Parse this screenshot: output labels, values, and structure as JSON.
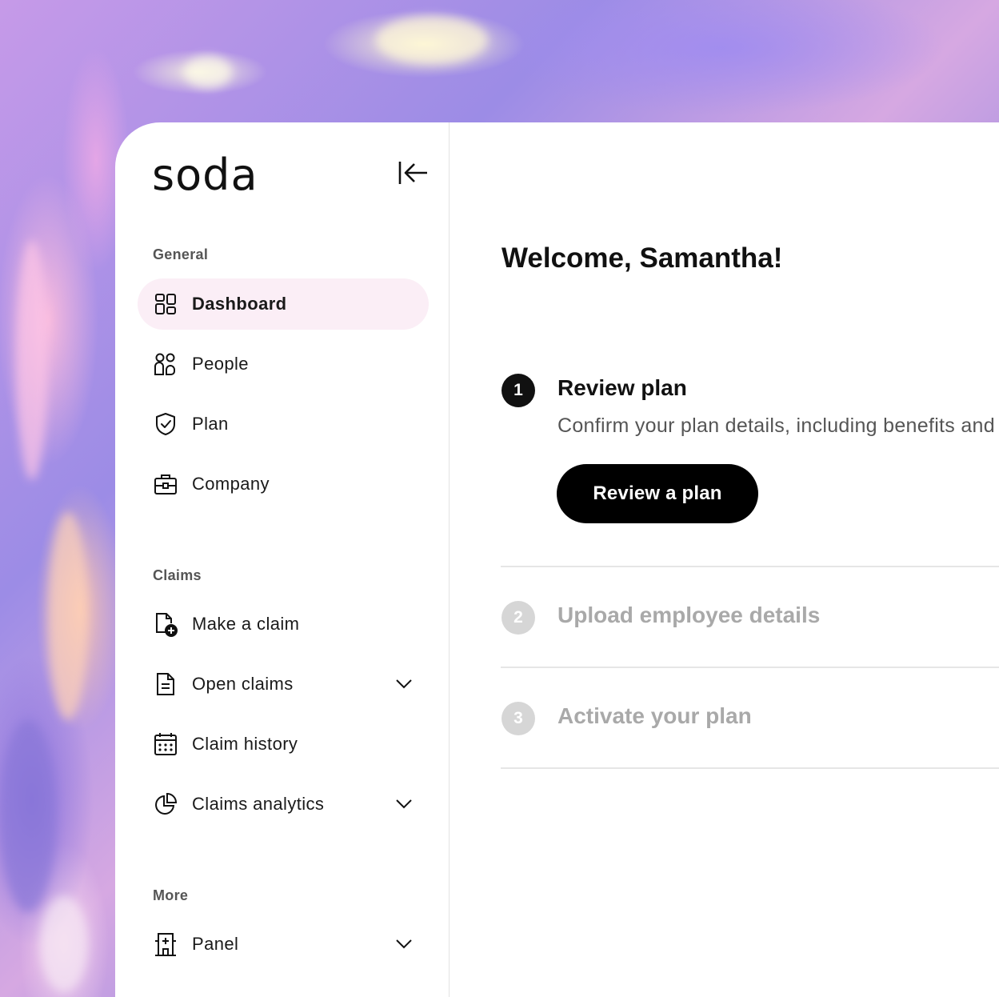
{
  "brand": {
    "logo_text": "soda"
  },
  "sidebar": {
    "collapse_icon": "collapse-left-icon",
    "sections": [
      {
        "label": "General"
      },
      {
        "label": "Claims"
      },
      {
        "label": "More"
      }
    ],
    "items": [
      {
        "label": "Dashboard",
        "icon": "dashboard-grid-icon",
        "active": true
      },
      {
        "label": "People",
        "icon": "people-icon"
      },
      {
        "label": "Plan",
        "icon": "shield-check-icon"
      },
      {
        "label": "Company",
        "icon": "briefcase-icon"
      },
      {
        "label": "Make a claim",
        "icon": "file-plus-icon"
      },
      {
        "label": "Open claims",
        "icon": "file-text-icon",
        "expandable": true
      },
      {
        "label": "Claim history",
        "icon": "calendar-icon"
      },
      {
        "label": "Claims analytics",
        "icon": "pie-chart-icon",
        "expandable": true
      },
      {
        "label": "Panel",
        "icon": "hospital-icon",
        "expandable": true
      }
    ]
  },
  "main": {
    "welcome": "Welcome, Samantha!",
    "steps": [
      {
        "number": "1",
        "title": "Review plan",
        "description": "Confirm your plan details, including benefits and",
        "button": "Review a plan",
        "active": true
      },
      {
        "number": "2",
        "title": "Upload employee details",
        "active": false
      },
      {
        "number": "3",
        "title": "Activate your plan",
        "active": false
      }
    ]
  },
  "colors": {
    "active_nav_bg": "#fbeef6",
    "primary": "#000000",
    "inactive_step": "#d6d6d6"
  }
}
